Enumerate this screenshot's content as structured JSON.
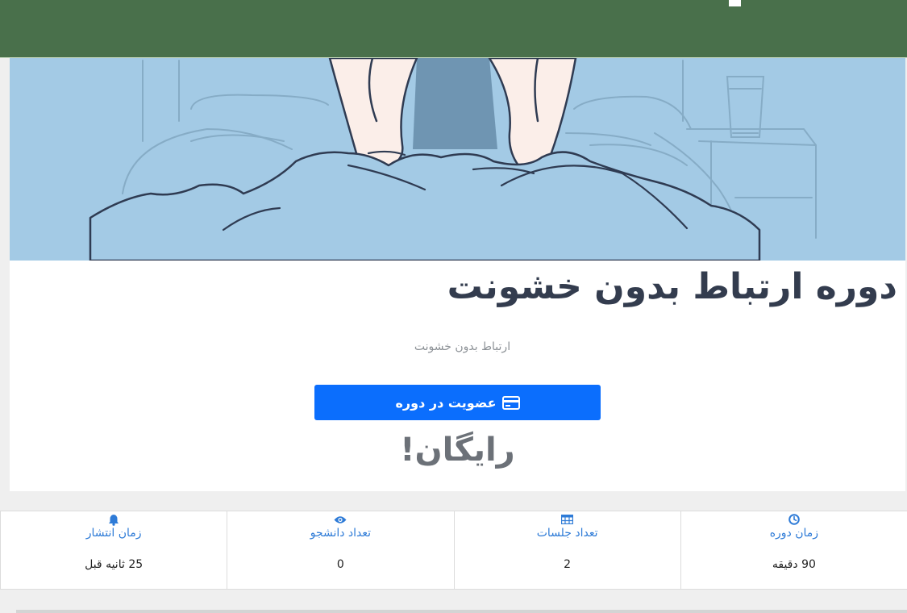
{
  "course": {
    "title": "دوره ارتباط بدون خشونت",
    "subtitle": "ارتباط بدون خشونت",
    "enroll_label": "عضویت در دوره",
    "price": "رایگان!"
  },
  "stats": [
    {
      "icon": "clock-icon",
      "label": "زمان دوره",
      "value": "90 دقیقه"
    },
    {
      "icon": "table-icon",
      "label": "تعداد جلسات",
      "value": "2"
    },
    {
      "icon": "eye-icon",
      "label": "تعداد دانشجو",
      "value": "0"
    },
    {
      "icon": "bell-icon",
      "label": "زمان انتشار",
      "value": "25 ثانیه قبل"
    }
  ],
  "colors": {
    "header": "#49704b",
    "hero_bg": "#a3cae5",
    "primary": "#0b6efd",
    "title": "#333c4e",
    "stat_label": "#2e7bd7"
  }
}
